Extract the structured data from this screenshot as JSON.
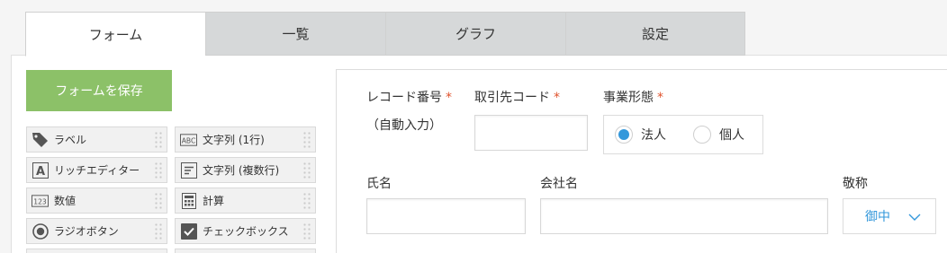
{
  "tabs": [
    {
      "label": "フォーム",
      "active": true
    },
    {
      "label": "一覧"
    },
    {
      "label": "グラフ"
    },
    {
      "label": "設定"
    }
  ],
  "save_button": "フォームを保存",
  "palette": [
    {
      "label": "ラベル",
      "icon": "tag-icon"
    },
    {
      "label": "文字列 (1行)",
      "icon": "abc-icon"
    },
    {
      "label": "リッチエディター",
      "icon": "rich-text-icon"
    },
    {
      "label": "文字列 (複数行)",
      "icon": "multiline-text-icon"
    },
    {
      "label": "数値",
      "icon": "number-icon"
    },
    {
      "label": "計算",
      "icon": "calculator-icon"
    },
    {
      "label": "ラジオボタン",
      "icon": "radio-icon"
    },
    {
      "label": "チェックボックス",
      "icon": "checkbox-icon"
    }
  ],
  "form": {
    "record_number": {
      "label": "レコード番号",
      "required": "*",
      "note": "（自動入力）"
    },
    "client_code": {
      "label": "取引先コード",
      "required": "*",
      "value": ""
    },
    "business_type": {
      "label": "事業形態",
      "required": "*",
      "options": [
        "法人",
        "個人"
      ],
      "selected": "法人"
    },
    "name": {
      "label": "氏名",
      "value": ""
    },
    "company": {
      "label": "会社名",
      "value": ""
    },
    "honorific": {
      "label": "敬称",
      "value": "御中"
    }
  },
  "colors": {
    "accent": "#3498db",
    "save_button": "#8cc168",
    "required": "#e0522c"
  }
}
